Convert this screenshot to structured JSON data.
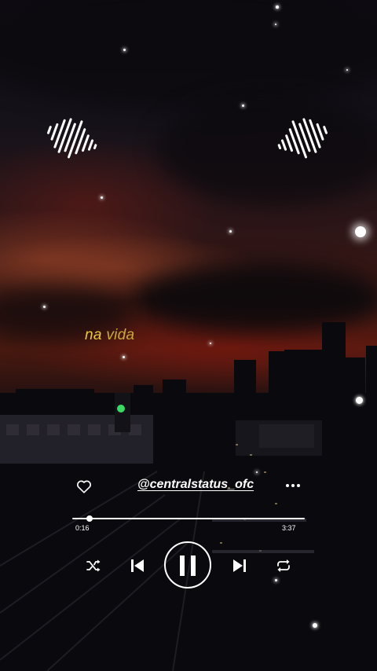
{
  "lyric": {
    "word1": "na",
    "word2": "vida"
  },
  "profile": {
    "handle": "@centralstatus_ofc"
  },
  "player": {
    "elapsed": "0:16",
    "duration": "3:37",
    "progress_fraction": 0.074
  },
  "icons": {
    "like": "heart-icon",
    "more": "more-dots-icon",
    "shuffle": "shuffle-icon",
    "previous": "skip-previous-icon",
    "pause": "pause-icon",
    "next": "skip-next-icon",
    "repeat": "repeat-icon",
    "decor_left": "sound-wave-icon",
    "decor_right": "sound-wave-icon"
  },
  "colors": {
    "lyric_primary": "#e8c840",
    "lyric_secondary": "#c8aa38",
    "controls": "#ffffff"
  }
}
